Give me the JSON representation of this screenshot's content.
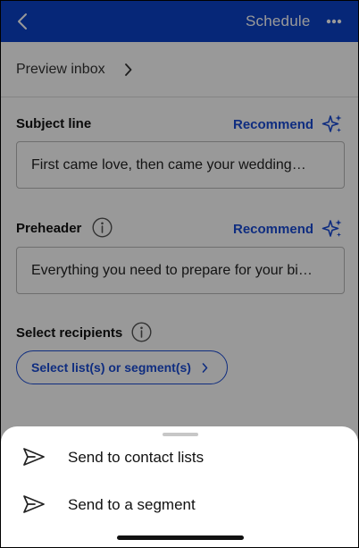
{
  "header": {
    "schedule_label": "Schedule"
  },
  "preview": {
    "label": "Preview inbox"
  },
  "subject": {
    "label": "Subject line",
    "recommend_label": "Recommend",
    "value": "First came love, then came your wedding…"
  },
  "preheader": {
    "label": "Preheader",
    "recommend_label": "Recommend",
    "value": "Everything you need to prepare for your bi…"
  },
  "recipients": {
    "label": "Select recipients",
    "button_label": "Select list(s) or segment(s)"
  },
  "sheet": {
    "items": [
      {
        "label": "Send to contact lists"
      },
      {
        "label": "Send to a segment"
      }
    ]
  },
  "colors": {
    "brand_blue": "#0a41c9",
    "accent_blue": "#1a4bd6",
    "overlay": "rgba(0,0,0,0.40)"
  },
  "icons": {
    "back": "chevron-left-icon",
    "more": "more-horizontal-icon",
    "sparkle": "sparkle-icon",
    "info": "info-icon",
    "send": "send-icon"
  }
}
